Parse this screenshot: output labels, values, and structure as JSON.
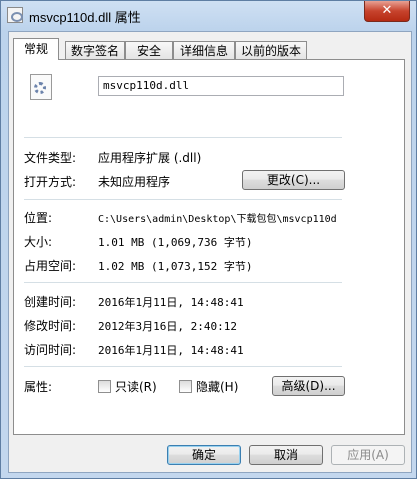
{
  "window": {
    "title": "msvcp110d.dll 属性",
    "close_glyph": "✕"
  },
  "tabs": [
    {
      "label": "常规",
      "active": true
    },
    {
      "label": "数字签名",
      "active": false
    },
    {
      "label": "安全",
      "active": false
    },
    {
      "label": "详细信息",
      "active": false
    },
    {
      "label": "以前的版本",
      "active": false
    }
  ],
  "general": {
    "file_name": "msvcp110d.dll",
    "file_type_label": "文件类型:",
    "file_type_value": "应用程序扩展 (.dll)",
    "opens_with_label": "打开方式:",
    "opens_with_value": "未知应用程序",
    "change_button": "更改(C)...",
    "location_label": "位置:",
    "location_value": "C:\\Users\\admin\\Desktop\\下载包包\\msvcp110d",
    "size_label": "大小:",
    "size_value": "1.01 MB (1,069,736 字节)",
    "size_on_disk_label": "占用空间:",
    "size_on_disk_value": "1.02 MB (1,073,152 字节)",
    "created_label": "创建时间:",
    "created_value": "2016年1月11日, 14:48:41",
    "modified_label": "修改时间:",
    "modified_value": "2012年3月16日, 2:40:12",
    "accessed_label": "访问时间:",
    "accessed_value": "2016年1月11日, 14:48:41",
    "attributes_label": "属性:",
    "readonly_label": "只读(R)",
    "readonly_checked": false,
    "hidden_label": "隐藏(H)",
    "hidden_checked": false,
    "advanced_button": "高级(D)..."
  },
  "footer": {
    "ok_button": "确定",
    "cancel_button": "取消",
    "apply_button": "应用(A)"
  }
}
